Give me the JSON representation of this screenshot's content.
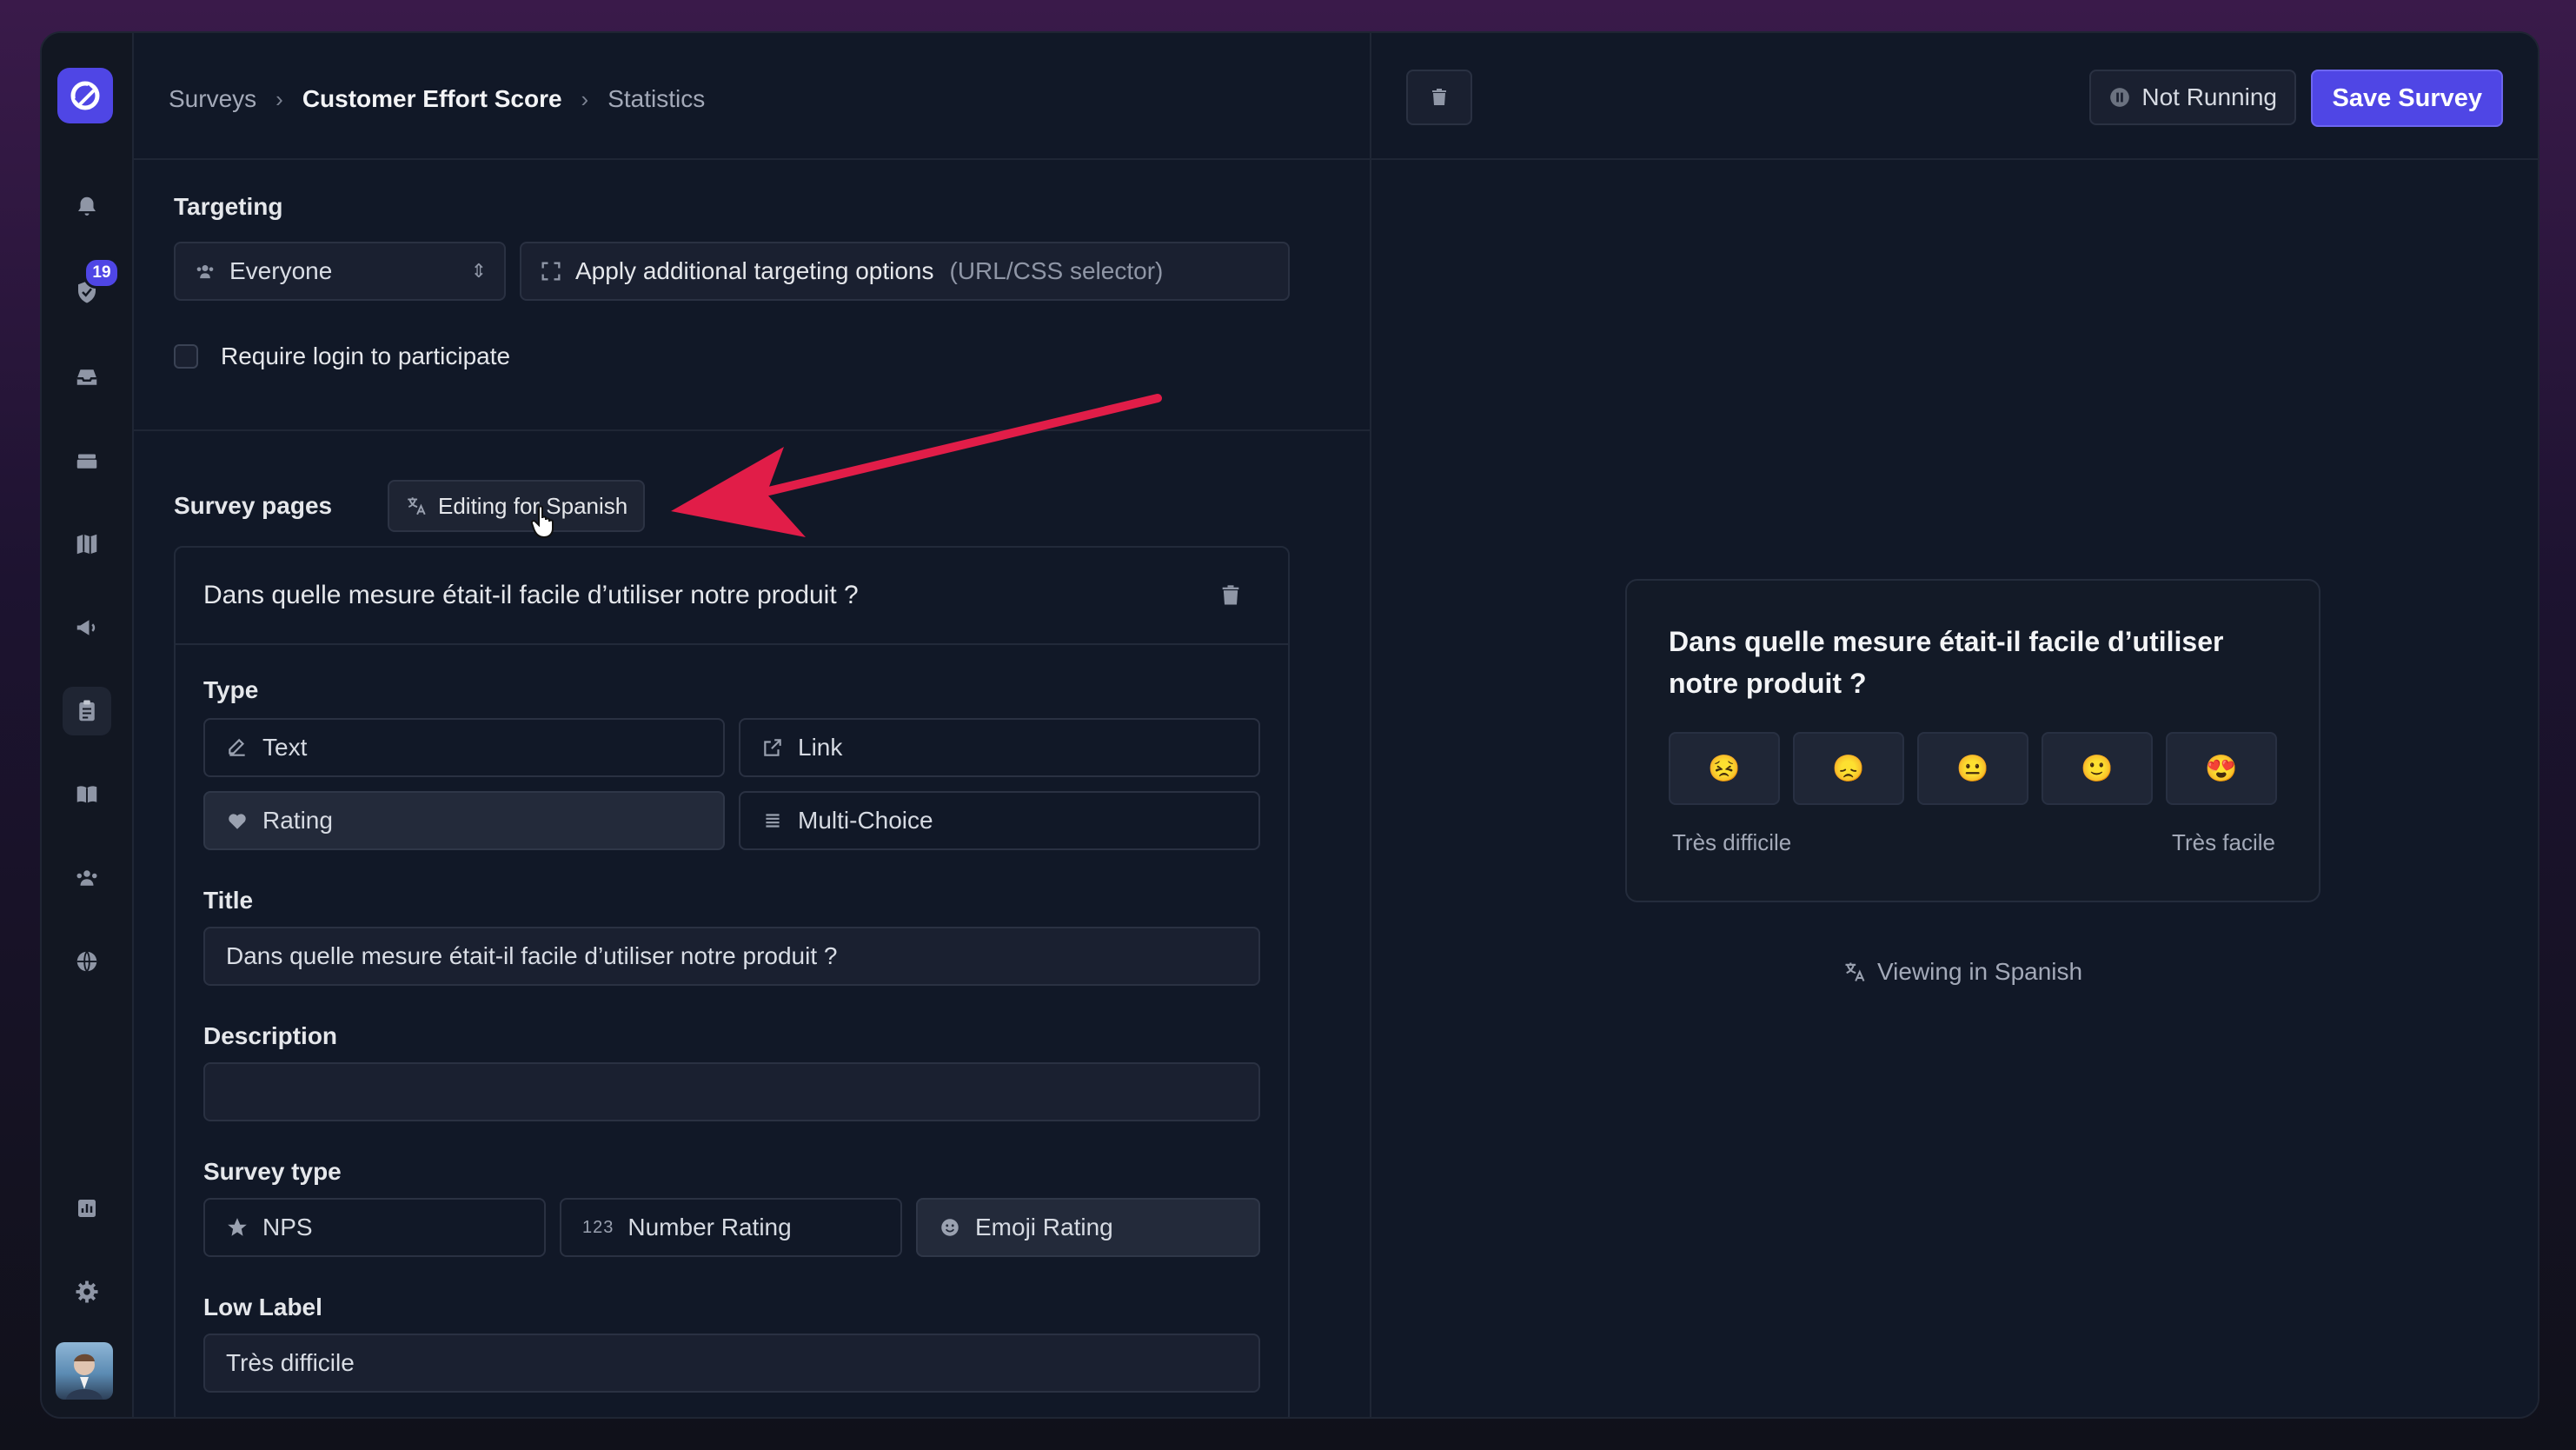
{
  "sidebar": {
    "badge_count": "19",
    "icons": [
      "bell-icon",
      "shield-check-icon",
      "inbox-icon",
      "stack-icon",
      "map-icon",
      "megaphone-icon",
      "clipboard-icon",
      "book-icon",
      "users-icon",
      "globe-icon",
      "chart-icon",
      "gear-icon"
    ]
  },
  "breadcrumb": {
    "root": "Surveys",
    "current": "Customer Effort Score",
    "tail": "Statistics"
  },
  "header": {
    "status_label": "Not Running",
    "save_label": "Save Survey"
  },
  "targeting": {
    "title": "Targeting",
    "audience": "Everyone",
    "additional_label": "Apply additional targeting options",
    "additional_hint": "(URL/CSS selector)",
    "require_login": "Require login to participate"
  },
  "survey_pages": {
    "title": "Survey pages",
    "language_badge": "Editing for Spanish"
  },
  "question": {
    "header_title": "Dans quelle mesure était-il facile d’utiliser notre produit ?",
    "type_label": "Type",
    "types": [
      "Text",
      "Link",
      "Rating",
      "Multi-Choice"
    ],
    "title_label": "Title",
    "title_value": "Dans quelle mesure était-il facile d’utiliser notre produit ?",
    "description_label": "Description",
    "description_value": "",
    "survey_type_label": "Survey type",
    "survey_types": [
      "NPS",
      "Number Rating",
      "Emoji Rating"
    ],
    "survey_type_hint": "123",
    "low_label_label": "Low Label",
    "low_label_value": "Très difficile"
  },
  "preview": {
    "question": "Dans quelle mesure était-il facile d’utiliser notre produit ?",
    "emojis": [
      "😣",
      "😞",
      "😐",
      "🙂",
      "😍"
    ],
    "low": "Très difficile",
    "high": "Très facile",
    "viewing": "Viewing in Spanish"
  },
  "colors": {
    "accent": "#4f46e5",
    "annotation_arrow": "#e11d48"
  }
}
